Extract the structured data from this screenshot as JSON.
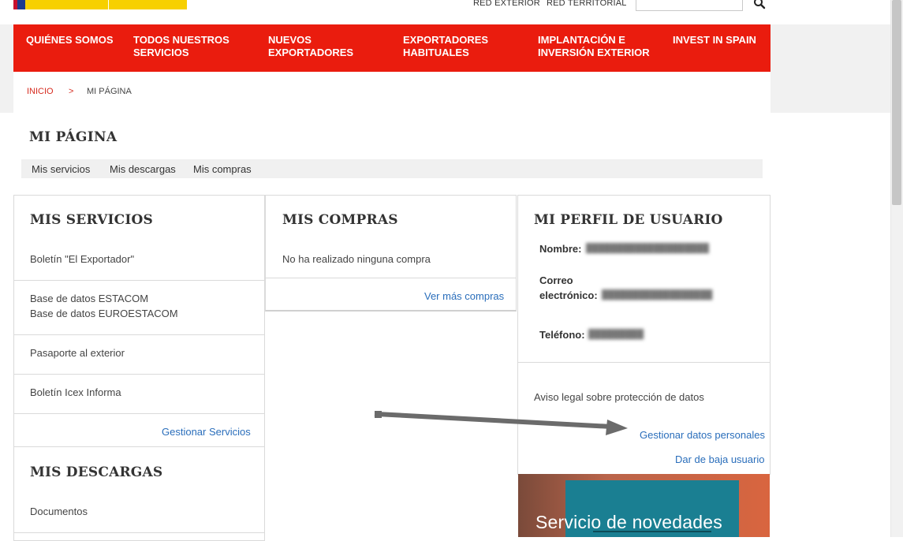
{
  "header": {
    "top_links": [
      "RED EXTERIOR",
      "RED TERRITORIAL"
    ],
    "search": {
      "placeholder": "",
      "icon": "search-icon"
    }
  },
  "nav": {
    "items": [
      "QUIÉNES SOMOS",
      "TODOS NUESTROS SERVICIOS",
      "NUEVOS EXPORTADORES",
      "EXPORTADORES HABITUALES",
      "IMPLANTACIÓN E INVERSIÓN EXTERIOR",
      "INVEST IN SPAIN"
    ],
    "lines": [
      [
        "QUIÉNES SOMOS"
      ],
      [
        "TODOS NUESTROS",
        "SERVICIOS"
      ],
      [
        "NUEVOS",
        "EXPORTADORES"
      ],
      [
        "EXPORTADORES",
        "HABITUALES"
      ],
      [
        "IMPLANTACIÓN E",
        "INVERSIÓN EXTERIOR"
      ],
      [
        "INVEST IN SPAIN"
      ]
    ],
    "color": "#ea1c0e"
  },
  "breadcrumb": {
    "home": "INICIO",
    "separator": ">",
    "current": "MI PÁGINA"
  },
  "page": {
    "title": "MI PÁGINA",
    "subnav": [
      "Mis servicios",
      "Mis descargas",
      "Mis compras"
    ]
  },
  "servicios": {
    "title": "MIS SERVICIOS",
    "items": [
      "Boletín \"El Exportador\"",
      "Base de datos ESTACOM",
      "Base de datos EUROESTACOM",
      "Pasaporte al exterior",
      "Boletín Icex Informa"
    ],
    "manage_link": "Gestionar Servicios"
  },
  "descargas": {
    "title": "MIS DESCARGAS",
    "items": [
      "Documentos"
    ]
  },
  "compras": {
    "title": "MIS COMPRAS",
    "empty_text": "No ha realizado ninguna compra",
    "more_link": "Ver más compras"
  },
  "perfil": {
    "title": "MI PERFIL DE USUARIO",
    "name_label": "Nombre:",
    "email_label_1": "Correo",
    "email_label_2": "electrónico:",
    "phone_label": "Teléfono:",
    "legal_text": "Aviso legal sobre protección de datos",
    "manage_link": "Gestionar datos personales",
    "unsubscribe_link": "Dar de baja usuario"
  },
  "banner": {
    "text": "Servicio de novedades"
  },
  "colors": {
    "accent_red": "#ea1c0e",
    "link_blue": "#2a6ebb",
    "logo_yellow": "#f7d000"
  }
}
